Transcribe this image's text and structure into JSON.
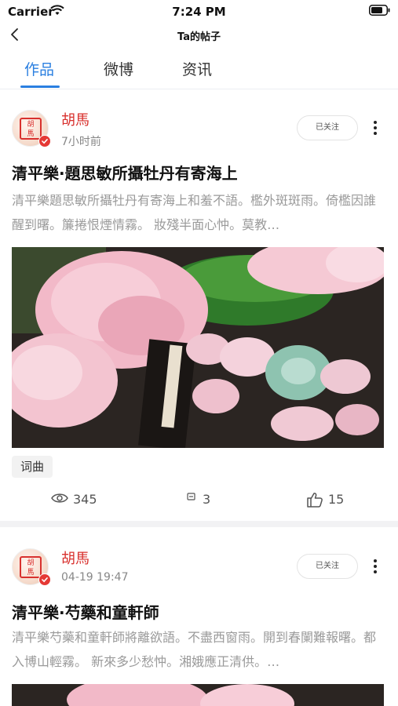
{
  "status_bar": {
    "carrier": "Carrier",
    "time": "7:24 PM"
  },
  "nav": {
    "title": "Ta的帖子"
  },
  "tabs": [
    {
      "label": "作品",
      "active": true
    },
    {
      "label": "微博",
      "active": false
    },
    {
      "label": "资讯",
      "active": false
    }
  ],
  "colors": {
    "accent": "#2a7fe0",
    "author": "#d8312e",
    "muted": "#9a9a9a"
  },
  "posts": [
    {
      "author": "胡馬",
      "time": "7小时前",
      "follow_label": "已关注",
      "title": "清平樂·題思敏所攝牡丹有寄海上",
      "excerpt": "清平樂題思敏所攝牡丹有寄海上和羞不語。檻外斑斑雨。倚檻因誰醒到曙。簾捲恨煙情霧。 妝殘半面心忡。莫教…",
      "image_desc_icon": "peony-photo",
      "tag": "词曲",
      "views": "345",
      "comments": "3",
      "likes": "15"
    },
    {
      "author": "胡馬",
      "time": "04-19 19:47",
      "follow_label": "已关注",
      "title": "清平樂·芍藥和童軒師",
      "excerpt": "清平樂芍藥和童軒師將離欲語。不盡西窗雨。開到春闌難報曙。都入博山輕霧。 新來多少愁忡。湘娥應正清供。…",
      "image_desc_icon": "peony-photo"
    }
  ]
}
